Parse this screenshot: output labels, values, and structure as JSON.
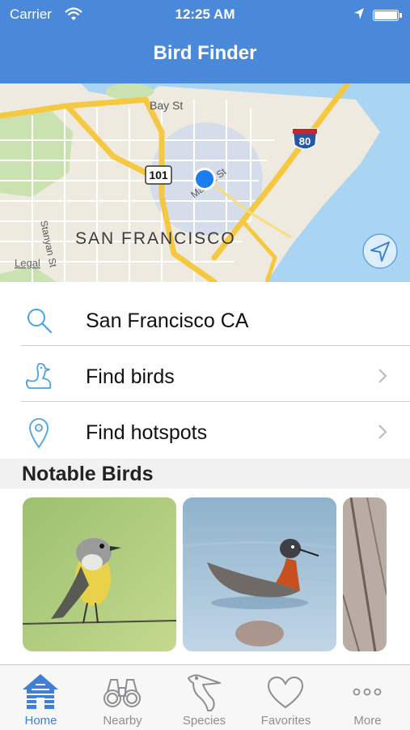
{
  "status_bar": {
    "carrier": "Carrier",
    "time": "12:25 AM"
  },
  "nav": {
    "title": "Bird Finder"
  },
  "map": {
    "labels": {
      "bay_st": "Bay St",
      "market_st": "Market St",
      "city": "SAN FRANCISCO",
      "stanyan_st": "Stanyan St",
      "legal": "Legal",
      "hwy_101": "101",
      "hwy_80": "80"
    }
  },
  "search": {
    "value": "San Francisco CA",
    "icon": "search-icon"
  },
  "menu": [
    {
      "label": "Find birds",
      "icon": "bird-icon"
    },
    {
      "label": "Find hotspots",
      "icon": "location-pin-icon"
    }
  ],
  "notable": {
    "heading": "Notable Birds",
    "birds": [
      {
        "subject": "yellow-bellied flycatcher on wire"
      },
      {
        "subject": "phalarope swimming"
      },
      {
        "subject": "partial bird photo"
      }
    ]
  },
  "tabs": [
    {
      "label": "Home",
      "icon": "house-icon",
      "active": true
    },
    {
      "label": "Nearby",
      "icon": "binoculars-icon",
      "active": false
    },
    {
      "label": "Species",
      "icon": "pelican-icon",
      "active": false
    },
    {
      "label": "Favorites",
      "icon": "heart-icon",
      "active": false
    },
    {
      "label": "More",
      "icon": "more-icon",
      "active": false
    }
  ],
  "colors": {
    "accent": "#4a88d9",
    "tab_active": "#3f7fd6",
    "tab_inactive": "#8e8e93",
    "icon_blue": "#4aa3df"
  }
}
